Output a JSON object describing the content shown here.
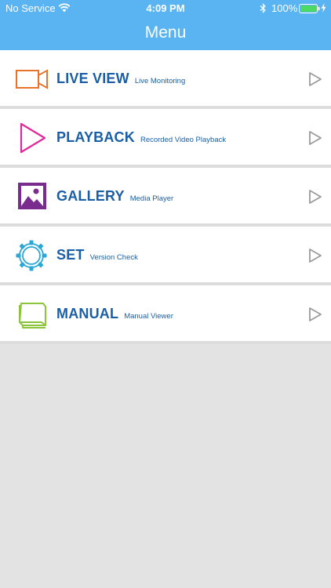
{
  "status_bar": {
    "carrier": "No Service",
    "time": "4:09 PM",
    "battery_percent": "100%"
  },
  "header": {
    "title": "Menu"
  },
  "menu": {
    "items": [
      {
        "label": "LIVE VIEW",
        "subtitle": "Live Monitoring",
        "icon": "video-camera-icon",
        "color": "#e8742a"
      },
      {
        "label": "PLAYBACK",
        "subtitle": "Recorded Video Playback",
        "icon": "play-icon",
        "color": "#e0289a"
      },
      {
        "label": "GALLERY",
        "subtitle": "Media Player",
        "icon": "image-icon",
        "color": "#7a2c8e"
      },
      {
        "label": "SET",
        "subtitle": "Version Check",
        "icon": "gear-icon",
        "color": "#2aa7d4"
      },
      {
        "label": "MANUAL",
        "subtitle": "Manual Viewer",
        "icon": "book-icon",
        "color": "#8cc43c"
      }
    ]
  },
  "colors": {
    "header_bg": "#5ab4f2",
    "label_text": "#1a5fa6",
    "background": "#e3e3e3"
  }
}
